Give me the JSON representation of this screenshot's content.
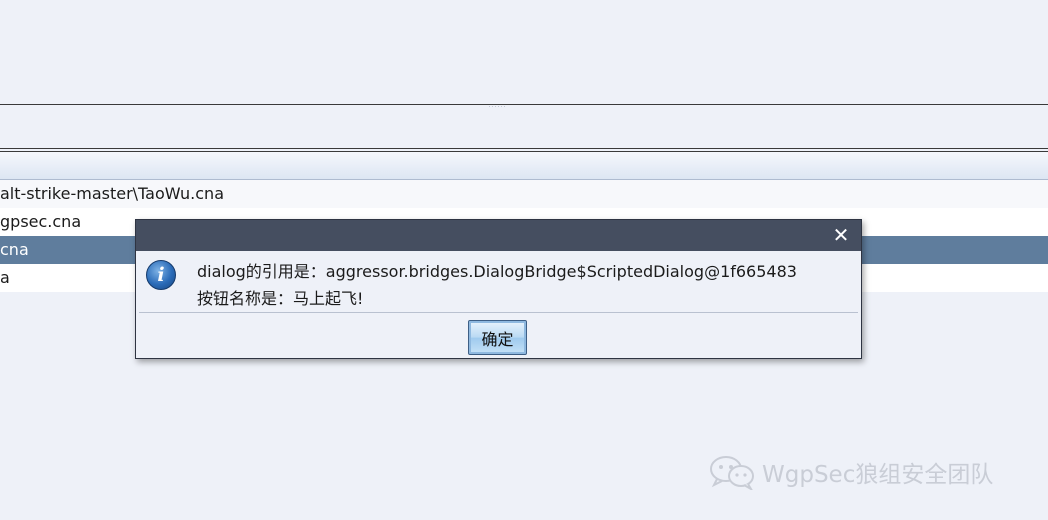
{
  "table": {
    "rows": [
      {
        "text": "alt-strike-master\\TaoWu.cna",
        "state": "odd"
      },
      {
        "text": "gpsec.cna",
        "state": "even"
      },
      {
        "text": "cna",
        "state": "selected"
      },
      {
        "text": "a",
        "state": "even"
      }
    ]
  },
  "dialog": {
    "icon": "info-icon",
    "close_label": "✕",
    "message_line1": "dialog的引用是：aggressor.bridges.DialogBridge$ScriptedDialog@1f665483",
    "message_line2": "按钮名称是：马上起飞!",
    "ok_label": "确定"
  },
  "watermark": {
    "icon": "wechat-icon",
    "text": "WgpSec狼组安全团队"
  },
  "colors": {
    "background": "#eef1f8",
    "titlebar": "#454e60",
    "selected_row": "#5f7d9d",
    "button_blue": "#b9d9f3"
  }
}
